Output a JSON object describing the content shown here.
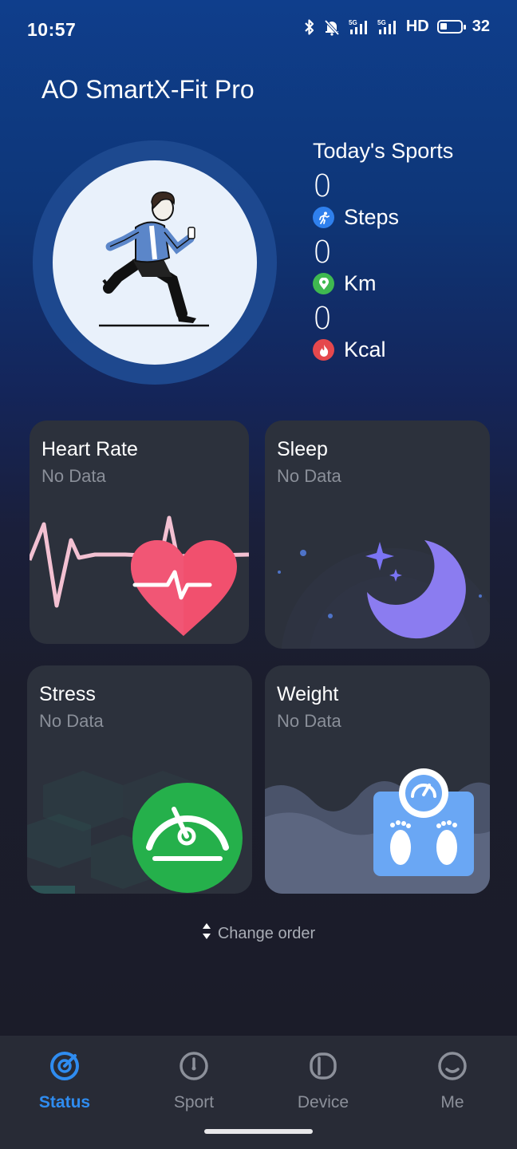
{
  "status_bar": {
    "time": "10:57",
    "network_1": "5G",
    "network_2": "5G",
    "hd": "HD",
    "battery": "32"
  },
  "app": {
    "title": "AO SmartX-Fit Pro"
  },
  "today": {
    "heading": "Today's Sports",
    "steps_value": "0",
    "steps_label": "Steps",
    "km_value": "0",
    "km_label": "Km",
    "kcal_value": "0",
    "kcal_label": "Kcal",
    "colors": {
      "steps": "#2f80ed",
      "km": "#3fb950",
      "kcal": "#e5484d"
    }
  },
  "cards": {
    "heart_rate": {
      "title": "Heart Rate",
      "sub": "No Data"
    },
    "sleep": {
      "title": "Sleep",
      "sub": "No Data"
    },
    "stress": {
      "title": "Stress",
      "sub": "No Data"
    },
    "weight": {
      "title": "Weight",
      "sub": "No Data"
    }
  },
  "change_order": {
    "label": "Change order"
  },
  "nav": {
    "status": "Status",
    "sport": "Sport",
    "device": "Device",
    "me": "Me",
    "active_color": "#2f8cf0"
  }
}
